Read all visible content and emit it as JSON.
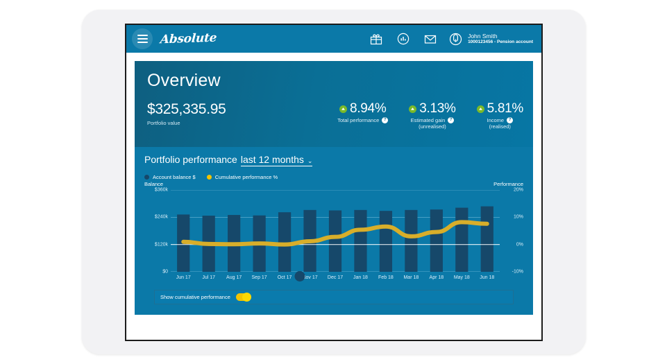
{
  "header": {
    "menu_icon": "hamburger-menu-icon",
    "brand": "Absolute",
    "icons": [
      {
        "name": "gift-icon"
      },
      {
        "name": "chart-circle-icon"
      },
      {
        "name": "envelope-icon"
      }
    ],
    "user": {
      "avatar_icon": "user-avatar-icon",
      "name": "John Smith",
      "account": "1000123456 - Pension account"
    }
  },
  "overview": {
    "title": "Overview",
    "portfolio_value": "$325,335.95",
    "portfolio_label": "Portfolio value",
    "metrics": [
      {
        "value": "8.94%",
        "label": "Total performance",
        "sub": "",
        "direction": "up",
        "help": "?"
      },
      {
        "value": "3.13%",
        "label": "Estimated gain",
        "sub": "(unrealised)",
        "direction": "up",
        "help": "?"
      },
      {
        "value": "5.81%",
        "label": "Income",
        "sub": "(realised)",
        "direction": "up",
        "help": "?"
      }
    ],
    "accent_green": "#7ab929"
  },
  "chart_section": {
    "title": "Portfolio performance",
    "period": "last 12 months",
    "caret": "⌄",
    "legend": [
      {
        "label": "Account balance $",
        "color": "#16486a"
      },
      {
        "label": "Cumulative performance %",
        "color": "#f2c300"
      }
    ],
    "left_axis_caption": "Balance",
    "right_axis_caption": "Performance"
  },
  "toggle": {
    "label": "Show cumulative performance",
    "state": "on",
    "color": "#f2c300"
  },
  "chart_data": {
    "type": "bar",
    "title": "Portfolio performance last 12 months",
    "xlabel": "",
    "ylabel": "Balance",
    "y2label": "Performance",
    "grid": true,
    "legend_position": "top-left",
    "categories": [
      "Jun 17",
      "Jul 17",
      "Aug 17",
      "Sep 17",
      "Oct 17",
      "Nov 17",
      "Dec 17",
      "Jan 18",
      "Feb 18",
      "Mar 18",
      "Apr 18",
      "May 18",
      "Jun 18"
    ],
    "ylim": [
      0,
      360000
    ],
    "yticks": [
      0,
      120000,
      240000,
      360000
    ],
    "ytick_labels": [
      "$0",
      "$120k",
      "$240k",
      "$360k"
    ],
    "y2lim": [
      -10,
      20
    ],
    "y2ticks": [
      -10,
      0,
      10,
      20
    ],
    "y2tick_labels": [
      "-10%",
      "0%",
      "10%",
      "20%"
    ],
    "series": [
      {
        "name": "Account balance $",
        "type": "bar",
        "axis": "left",
        "color": "#16486a",
        "values": [
          252000,
          247000,
          250000,
          248000,
          262000,
          272000,
          270000,
          272000,
          268000,
          272000,
          274000,
          282000,
          288000
        ]
      },
      {
        "name": "Cumulative performance %",
        "type": "line",
        "axis": "right",
        "color": "#d8ae2a",
        "values": [
          1.0,
          0.2,
          0.1,
          0.4,
          0.0,
          1.2,
          2.8,
          5.4,
          6.6,
          3.0,
          4.6,
          8.2,
          7.6
        ]
      }
    ],
    "annotations": [
      {
        "name": "axis-handle",
        "at_category_index": 4.6
      }
    ]
  }
}
